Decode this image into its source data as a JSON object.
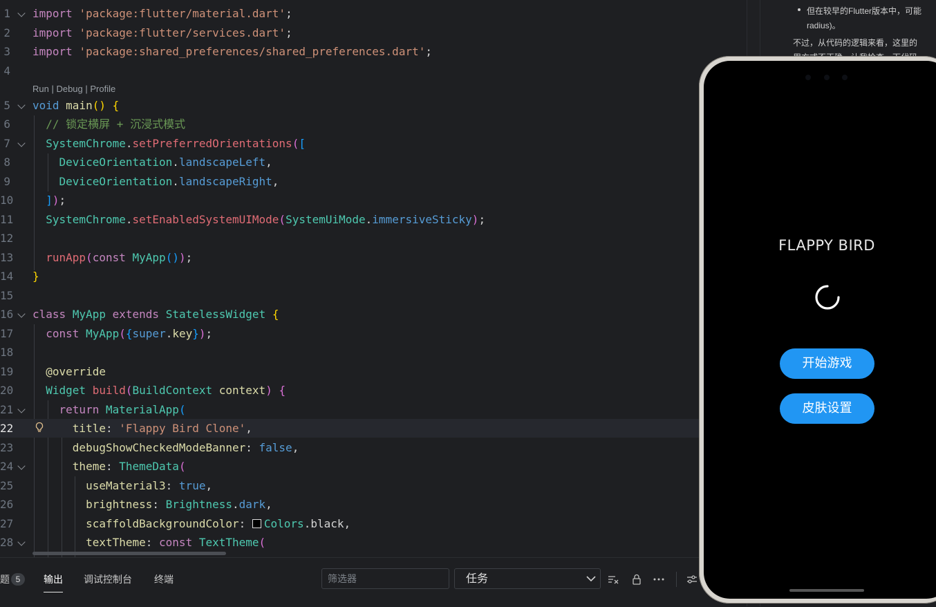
{
  "editor": {
    "codelens": "Run | Debug | Profile",
    "lines": [
      {
        "n": "1"
      },
      {
        "n": "2"
      },
      {
        "n": "3"
      },
      {
        "n": "4"
      },
      {
        "n": "5"
      },
      {
        "n": "6"
      },
      {
        "n": "7"
      },
      {
        "n": "8"
      },
      {
        "n": "9"
      },
      {
        "n": "10"
      },
      {
        "n": "11"
      },
      {
        "n": "12"
      },
      {
        "n": "13"
      },
      {
        "n": "14"
      },
      {
        "n": "15"
      },
      {
        "n": "16"
      },
      {
        "n": "17"
      },
      {
        "n": "18"
      },
      {
        "n": "19"
      },
      {
        "n": "20"
      },
      {
        "n": "21"
      },
      {
        "n": "22"
      },
      {
        "n": "23"
      },
      {
        "n": "24"
      },
      {
        "n": "25"
      },
      {
        "n": "26"
      },
      {
        "n": "27"
      },
      {
        "n": "28"
      }
    ],
    "code": {
      "l1_kw": "import",
      "l1_str": "'package:flutter/material.dart'",
      "l2_kw": "import",
      "l2_str": "'package:flutter/services.dart'",
      "l3_kw": "import",
      "l3_str": "'package:shared_preferences/shared_preferences.dart'",
      "l5_type": "void",
      "l5_fn": "main",
      "l6_comment": "// 锁定横屏 + 沉浸式模式",
      "l7_cls": "SystemChrome",
      "l7_fn": "setPreferredOrientations",
      "l8_cls": "DeviceOrientation",
      "l8_prop": "landscapeLeft",
      "l9_cls": "DeviceOrientation",
      "l9_prop": "landscapeRight",
      "l11_cls": "SystemChrome",
      "l11_fn": "setEnabledSystemUIMode",
      "l11_arg_cls": "SystemUiMode",
      "l11_arg_prop": "immersiveSticky",
      "l13_fn": "runApp",
      "l13_kw": "const",
      "l13_cls": "MyApp",
      "l16_kw": "class",
      "l16_cls": "MyApp",
      "l16_kw2": "extends",
      "l16_cls2": "StatelessWidget",
      "l17_kw": "const",
      "l17_cls": "MyApp",
      "l17_super": "super",
      "l17_key": "key",
      "l19_ann": "@override",
      "l20_cls": "Widget",
      "l20_fn": "build",
      "l20_arg_cls": "BuildContext",
      "l20_arg": "context",
      "l21_kw": "return",
      "l21_cls": "MaterialApp",
      "l22_key": "title",
      "l22_str": "'Flappy Bird Clone'",
      "l23_key": "debugShowCheckedModeBanner",
      "l23_val": "false",
      "l24_key": "theme",
      "l24_cls": "ThemeData",
      "l25_key": "useMaterial3",
      "l25_val": "true",
      "l26_key": "brightness",
      "l26_cls": "Brightness",
      "l26_prop": "dark",
      "l27_key": "scaffoldBackgroundColor",
      "l27_cls": "Colors",
      "l27_prop": "black",
      "l28_key": "textTheme",
      "l28_kw": "const",
      "l28_cls": "TextTheme"
    }
  },
  "panel": {
    "problems_label": "题",
    "problems_count": "5",
    "tabs": [
      {
        "label": "输出"
      },
      {
        "label": "调试控制台"
      },
      {
        "label": "终端"
      }
    ],
    "filter_placeholder": "筛选器",
    "task_select": "任务"
  },
  "chat": {
    "bullet": "但在较早的Flutter版本中，可能",
    "bullet_cont": "radius)。",
    "para": "不过，从代码的逻辑来看，这里的",
    "para2": "用方式不正确。让我检查一下代码"
  },
  "app": {
    "title": "FLAPPY BIRD",
    "start_button": "开始游戏",
    "skin_button": "皮肤设置",
    "accent": "#2196f3"
  }
}
